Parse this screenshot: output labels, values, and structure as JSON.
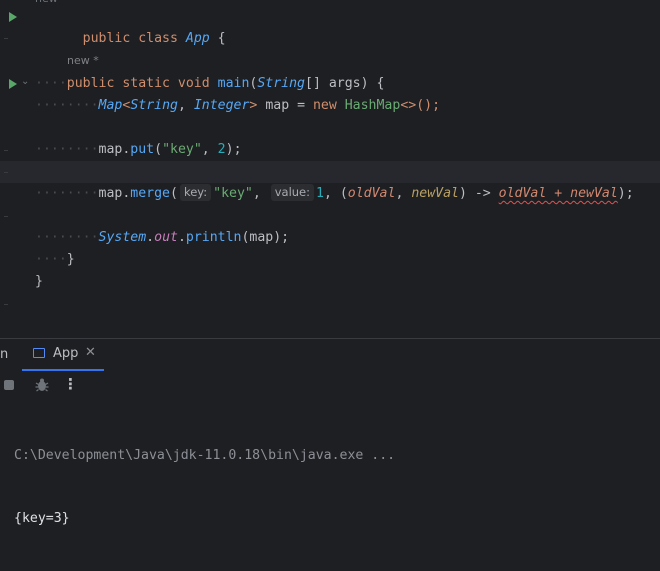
{
  "editor": {
    "top_cut_text": "new",
    "usage_hint": "new *",
    "lines": {
      "l1": {
        "kw": "public class",
        "cls": "App",
        "rest": " {"
      },
      "l3": {
        "kw": "public static void",
        "fn": "main",
        "p1": "(",
        "t": "String",
        "p2": "[] args) {"
      },
      "l4": {
        "t1": "Map",
        "lt": "<",
        "t2": "String",
        "c": ", ",
        "t3": "Integer",
        "gt": ">",
        "mid": " map = ",
        "kw": "new",
        "sp": " ",
        "ctor": "HashMap",
        "tail": "<>();"
      },
      "l6": {
        "a": "map.",
        "fn": "put",
        "b": "(",
        "s": "\"key\"",
        "c": ", ",
        "n": "2",
        "d": ");"
      },
      "l8": {
        "a": "map.",
        "fn": "merge",
        "b": "(",
        "h1": "key:",
        "s": "\"key\"",
        "c": ", ",
        "h2": "value:",
        "n": "1",
        "d": ", (",
        "p1": "oldVal",
        "e": ", ",
        "p2": "newVal",
        "f": ") -> ",
        "g": "oldVal + newVal",
        "h": ");"
      },
      "l10": {
        "cls": "System",
        "dot": ".",
        "out": "out",
        "mid": ".",
        "fn": "println",
        "tail": "(map);"
      },
      "l11": {
        "brace": "}"
      },
      "l12": {
        "brace": "}"
      }
    }
  },
  "run_panel": {
    "left_tab_fragment": "n",
    "tab_label": "App",
    "tab_close": "✕",
    "console": {
      "command": "C:\\Development\\Java\\jdk-11.0.18\\bin\\java.exe ...",
      "output": "{key=3}"
    }
  },
  "icons": {
    "run": "run-gutter-icon",
    "stop": "stop-icon",
    "debug": "bug-icon",
    "more": "more-options-icon",
    "window": "app-window-icon"
  },
  "colors": {
    "keyword": "#cf8e6d",
    "string": "#6aab73",
    "number": "#2aacb8",
    "type": "#56a8f5",
    "run_green": "#59a869",
    "tab_underline": "#3574f0"
  }
}
